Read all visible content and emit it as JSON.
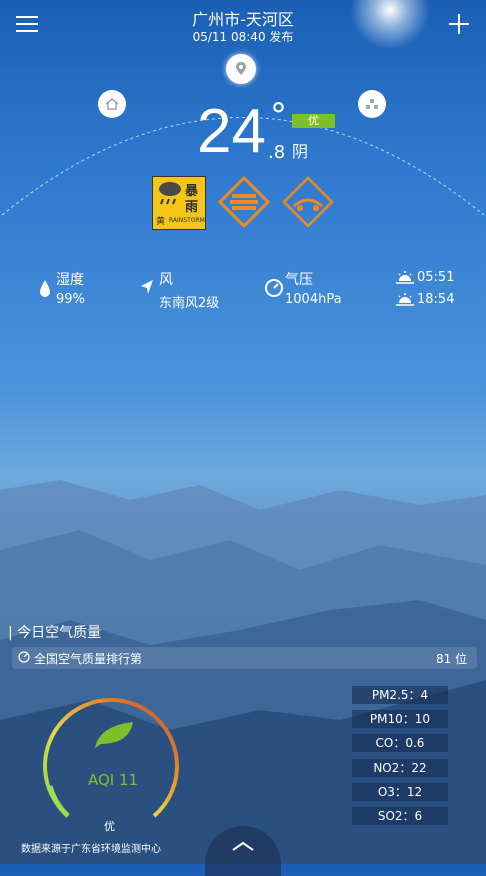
{
  "header": {
    "city": "广州市-天河区",
    "publish_time": "05/11  08:40 发布",
    "menu_icon": "menu-icon",
    "add_icon": "plus-icon"
  },
  "current": {
    "temp": "24",
    "degree": "°",
    "decimal": ".8",
    "condition": "阴",
    "aqi_label": "优"
  },
  "warnings": [
    {
      "name": "rainstorm-warning-icon",
      "text_1": "暴",
      "text_2": "雨",
      "text_3": "黄",
      "text_4": "RAINSTORM"
    },
    {
      "name": "thunder-warning-icon"
    },
    {
      "name": "traffic-warning-icon"
    }
  ],
  "stats": {
    "humidity_label": "湿度",
    "humidity_value": "99%",
    "wind_label": "风",
    "wind_value": "东南风2级",
    "pressure_label": "气压",
    "pressure_value": "1004hPa",
    "sunrise": "05:51",
    "sunset": "18:54"
  },
  "air": {
    "section_title": "| 今日空气质量",
    "rank_label": "全国空气质量排行第",
    "rank_value": "81 位",
    "aqi_text": "AQI 11",
    "aqi_level": "优",
    "aqi_fraction": 0.05,
    "pollutants": [
      {
        "text": "PM2.5：4"
      },
      {
        "text": "PM10：10"
      },
      {
        "text": "CO：0.6"
      },
      {
        "text": "NO2：22"
      },
      {
        "text": "O3：12"
      },
      {
        "text": "SO2：6"
      }
    ],
    "source": "数据来源于广东省环境监测中心"
  },
  "colors": {
    "aqi_good": "#7cc12c",
    "warning_yellow": "#f5c518",
    "warning_orange": "#f08a1c"
  }
}
